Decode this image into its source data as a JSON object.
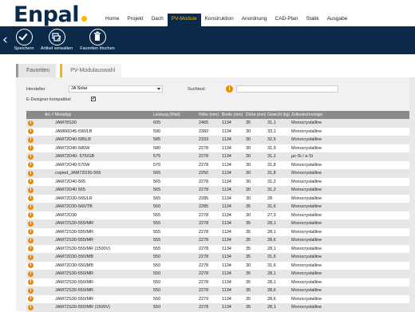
{
  "brand": {
    "logo": "Enpal",
    "accent": "#f5b700",
    "navy": "#0b2a4a"
  },
  "nav": [
    {
      "label": "Home"
    },
    {
      "label": "Projekt"
    },
    {
      "label": "Dach"
    },
    {
      "label": "PV-Module",
      "active": true
    },
    {
      "label": "Konstruktion"
    },
    {
      "label": "Anordnung"
    },
    {
      "label": "CAD-Plan"
    },
    {
      "label": "Statik"
    },
    {
      "label": "Ausgabe"
    }
  ],
  "toolbar": {
    "save_label": "Speichern",
    "manage_label": "Artikel verwalten",
    "delete_label": "Favoriten löschen"
  },
  "tabs": {
    "favoriten": "Favoriten",
    "auswahl": "PV-Modulauswahl"
  },
  "filters": {
    "hersteller_label": "Hersteller",
    "hersteller_value": "JA Solar",
    "suchtext_label": "Suchtext:",
    "suchtext_value": "",
    "edesigner_label": "E-Designer kompatibel",
    "edesigner_checked": "✔"
  },
  "table": {
    "columns": [
      "",
      "Art.-Nr.",
      "Modultyp",
      "Leistung (Watt)",
      "Höhe (mm)",
      "Breite (mm)",
      "Dicke (mm)",
      "Gewicht (kg)",
      "Zellentechnologie"
    ],
    "rows": [
      [
        "",
        "JAM78S30",
        "605",
        "2465",
        "1134",
        "35",
        "31,1",
        "Monocrystalline"
      ],
      [
        "",
        "JAM66D45-590/LB",
        "590",
        "2382",
        "1134",
        "30",
        "33,1",
        "Monocrystalline"
      ],
      [
        "",
        "JAM72D40-585LB",
        "585",
        "2333",
        "1134",
        "30",
        "32,5",
        "Monocrystalline"
      ],
      [
        "",
        "JAM72D40-580W",
        "580",
        "2278",
        "1134",
        "30",
        "31,9",
        "Monocrystalline"
      ],
      [
        "",
        "JAM72D40- 575/GB",
        "575",
        "2278",
        "1134",
        "30",
        "31,2",
        "µc-Si / a-Si"
      ],
      [
        "",
        "JAM72D40-570W",
        "570",
        "2278",
        "1134",
        "30",
        "31,8",
        "Monocrystalline"
      ],
      [
        "",
        "copied_JAM72D30-565",
        "565",
        "2250",
        "1134",
        "30",
        "31,8",
        "Monocrystalline"
      ],
      [
        "",
        "JAM72D40-565",
        "565",
        "2278",
        "1134",
        "30",
        "31,2",
        "Monocrystalline"
      ],
      [
        "",
        "JAM72D40 565",
        "565",
        "2278",
        "1134",
        "30",
        "31,2",
        "Monocrystalline"
      ],
      [
        "",
        "JAM72D30-565/LR",
        "565",
        "2285",
        "1134",
        "30",
        "28",
        "Monocrystalline"
      ],
      [
        "",
        "JAM72D30-560/TB",
        "560",
        "2285",
        "1134",
        "35",
        "31,6",
        "Monocrystalline"
      ],
      [
        "",
        "JAM72D30",
        "555",
        "2278",
        "1134",
        "30",
        "27,3",
        "Monocrystalline"
      ],
      [
        "",
        "JAM72S30-555/MR",
        "555",
        "2278",
        "1134",
        "35",
        "28,1",
        "Monocrystalline"
      ],
      [
        "",
        "JAM72S30-555/MR",
        "555",
        "2278",
        "1134",
        "35",
        "28,1",
        "Monocrystalline"
      ],
      [
        "",
        "JAM72S30-555/MR",
        "555",
        "2278",
        "1134",
        "35",
        "28,6",
        "Monocrystalline"
      ],
      [
        "",
        "JAM72S30-555/MR (1500V)",
        "555",
        "2278",
        "1134",
        "35",
        "28,1",
        "Monocrystalline"
      ],
      [
        "",
        "JAM72D30-550/MB",
        "550",
        "2278",
        "1134",
        "35",
        "31,6",
        "Monocrystalline"
      ],
      [
        "",
        "JAM72D30-550/MB",
        "550",
        "2278",
        "1134",
        "30",
        "31,6",
        "Monocrystalline"
      ],
      [
        "",
        "JAM72S30-550/MR",
        "550",
        "2278",
        "1134",
        "35",
        "28,1",
        "Monocrystalline"
      ],
      [
        "",
        "JAM72S30-550/MR",
        "550",
        "2278",
        "1134",
        "35",
        "28,1",
        "Monocrystalline"
      ],
      [
        "",
        "JAM72S30-550/MR",
        "550",
        "2278",
        "1134",
        "35",
        "28,6",
        "Monocrystalline"
      ],
      [
        "",
        "JAM72S30-550/MR",
        "550",
        "2279",
        "1134",
        "35",
        "28,6",
        "Monocrystalline"
      ],
      [
        "",
        "JAM72S30-550/MR (1500V)",
        "550",
        "2278",
        "1134",
        "35",
        "28,1",
        "Monocrystalline"
      ]
    ]
  }
}
